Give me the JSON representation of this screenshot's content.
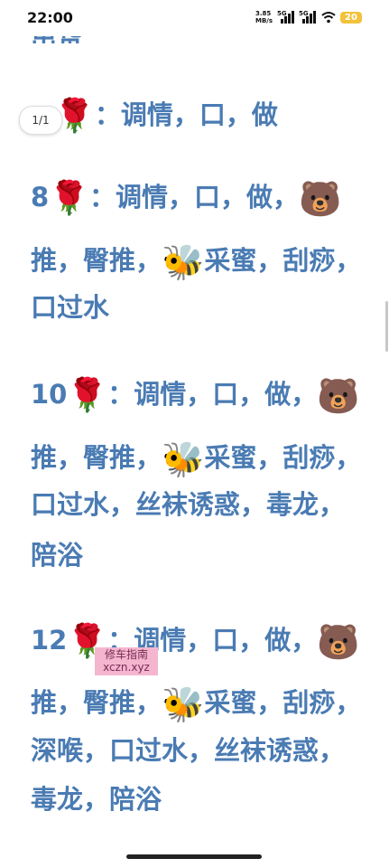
{
  "status_bar": {
    "time": "22:00",
    "net_speed_value": "3.85",
    "net_speed_unit": "MB/s",
    "signal1_tag": "5G",
    "signal2_tag": "5G",
    "battery": "20"
  },
  "page_indicator": "1/1",
  "watermark": {
    "line1": "修车指南",
    "line2": "xczn.xyz"
  },
  "icons": {
    "rose": "🌹",
    "bear": "🐻",
    "bee": "🐝"
  },
  "content": {
    "top_partial": "出货",
    "item1": {
      "number": "",
      "line1_text": "：调情，口，做"
    },
    "item2": {
      "number": "8",
      "line1_text": "：调情，口，做，",
      "line2_a": "推，臀推，",
      "line2_b": "采蜜，刮痧，",
      "line3": "口过水"
    },
    "item3": {
      "number": "10",
      "line1_text": "：调情，口，做，",
      "line2_a": "推，臀推，",
      "line2_b": "采蜜，刮痧，",
      "line3": "口过水，丝袜诱惑，毒龙，",
      "line4": "陪浴"
    },
    "item4": {
      "number": "12",
      "line1_text": "：调情，口，做，",
      "line2_a": "推，臀推，",
      "line2_b": "采蜜，刮痧，",
      "line3": "深喉，口过水，丝袜诱惑，",
      "line4": "毒龙，陪浴"
    }
  }
}
